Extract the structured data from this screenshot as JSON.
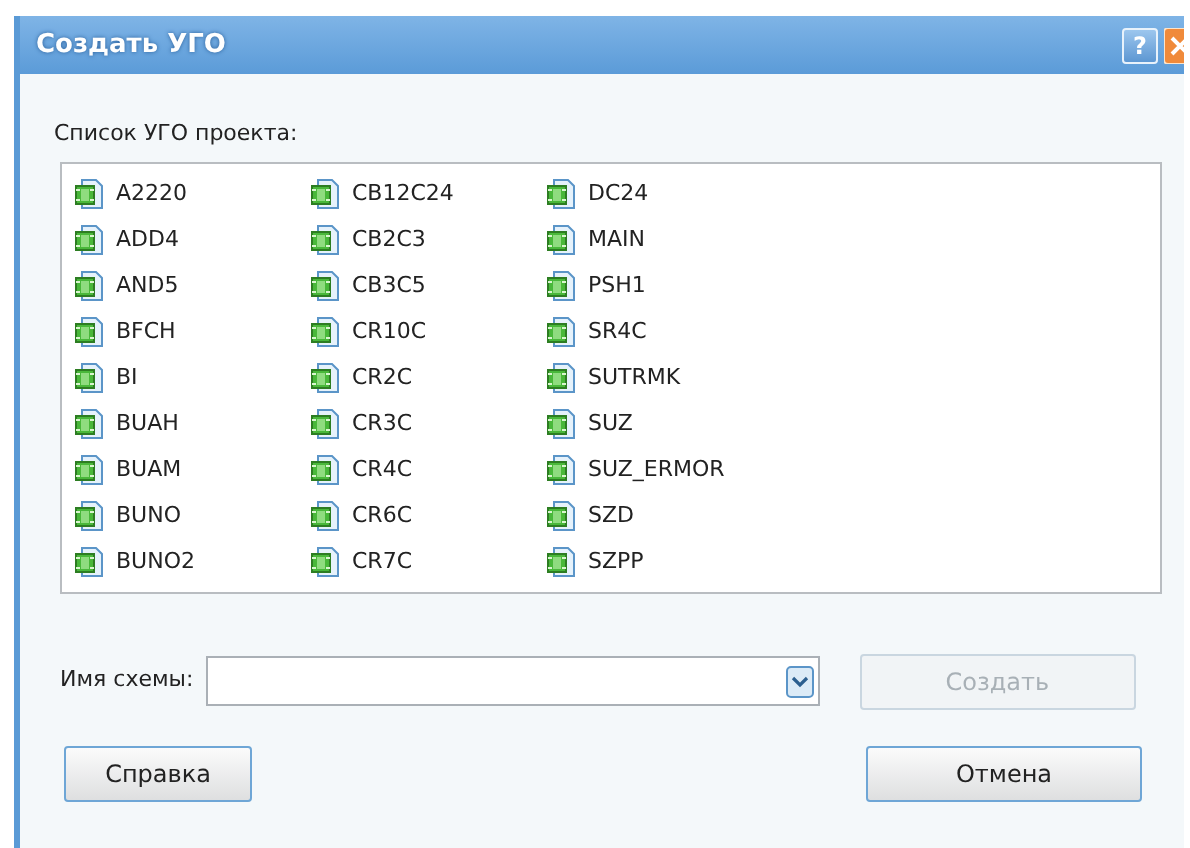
{
  "window": {
    "title": "Создать УГО",
    "help_button": "?"
  },
  "list": {
    "label": "Список УГО проекта:",
    "items": [
      {
        "name": "A2220"
      },
      {
        "name": "ADD4"
      },
      {
        "name": "AND5"
      },
      {
        "name": "BFCH"
      },
      {
        "name": "BI"
      },
      {
        "name": "BUAH"
      },
      {
        "name": "BUAM"
      },
      {
        "name": "BUNO"
      },
      {
        "name": "BUNO2"
      },
      {
        "name": "CB12C24"
      },
      {
        "name": "CB2C3"
      },
      {
        "name": "CB3C5"
      },
      {
        "name": "CR10C"
      },
      {
        "name": "CR2C"
      },
      {
        "name": "CR3C"
      },
      {
        "name": "CR4C"
      },
      {
        "name": "CR6C"
      },
      {
        "name": "CR7C"
      },
      {
        "name": "DC24"
      },
      {
        "name": "MAIN"
      },
      {
        "name": "PSH1"
      },
      {
        "name": "SR4C"
      },
      {
        "name": "SUTRMK"
      },
      {
        "name": "SUZ"
      },
      {
        "name": "SUZ_ERMOR"
      },
      {
        "name": "SZD"
      },
      {
        "name": "SZPP"
      }
    ]
  },
  "name_field": {
    "label": "Имя схемы:"
  },
  "buttons": [
    {
      "kind": "create",
      "label": "Создать",
      "disabled": true
    },
    {
      "kind": "help",
      "label": "Справка",
      "disabled": false
    },
    {
      "kind": "cancel",
      "label": "Отмена",
      "disabled": false
    }
  ]
}
